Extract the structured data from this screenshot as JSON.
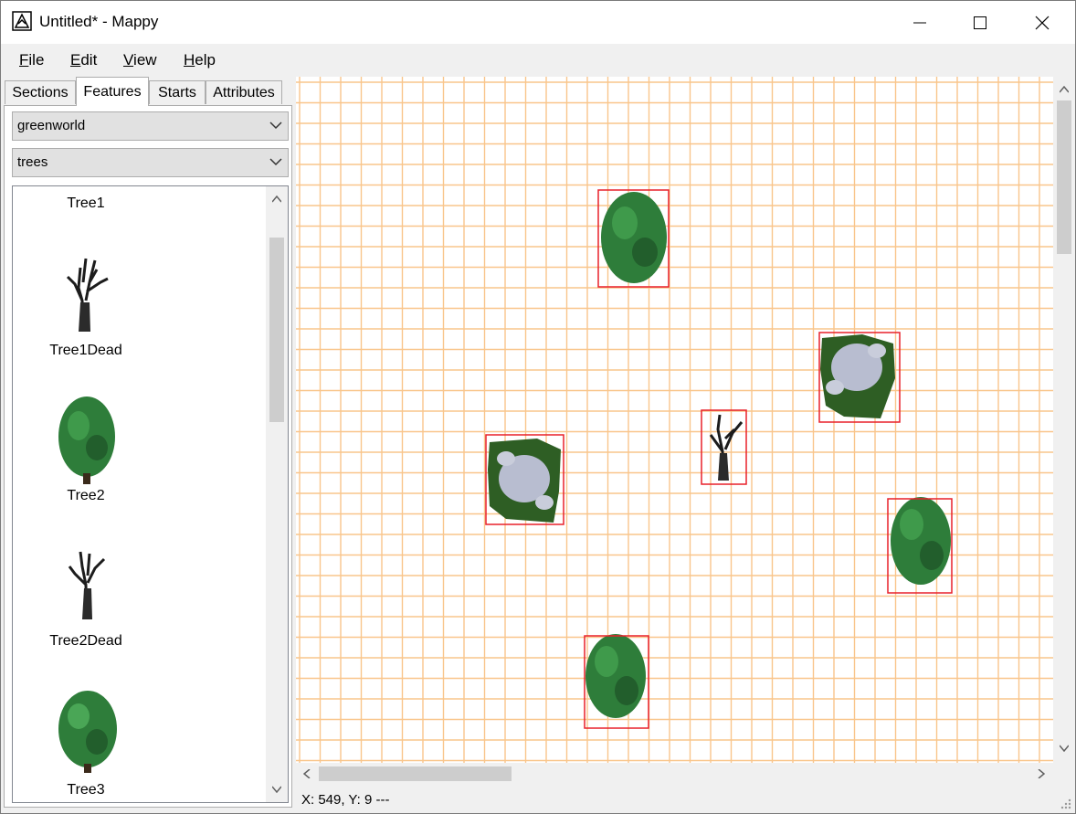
{
  "window": {
    "title": "Untitled* - Mappy"
  },
  "menu": {
    "items": [
      {
        "label": "File",
        "mnemonic": "F",
        "rest": "ile"
      },
      {
        "label": "Edit",
        "mnemonic": "E",
        "rest": "dit"
      },
      {
        "label": "View",
        "mnemonic": "V",
        "rest": "iew"
      },
      {
        "label": "Help",
        "mnemonic": "H",
        "rest": "elp"
      }
    ]
  },
  "tabs": [
    "Sections",
    "Features",
    "Starts",
    "Attributes"
  ],
  "active_tab": "Features",
  "panel": {
    "world_select": "greenworld",
    "category_select": "trees",
    "features": [
      "Tree1",
      "Tree1Dead",
      "Tree2",
      "Tree2Dead",
      "Tree3"
    ]
  },
  "status": {
    "text": "X: 549, Y: 9  ---"
  },
  "colors": {
    "grid": "#f9c58b",
    "selection": "#e8202a",
    "foliage": "#2e7d3a",
    "dead": "#1c1c1c",
    "rock": "#b8bdd0"
  }
}
